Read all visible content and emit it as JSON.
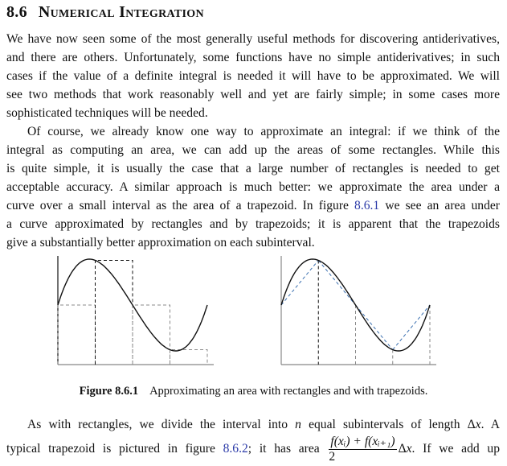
{
  "section": {
    "number": "8.6",
    "title": "Numerical Integration"
  },
  "paragraph1": [
    "We have now seen some of the most generally useful methods for discovering antiderivatives,",
    "and there are others. Unfortunately, some functions have no simple antiderivatives; in such",
    "cases if the value of a definite integral is needed it will have to be approximated. We will",
    "see two methods that work reasonably well and yet are fairly simple; in some cases more",
    "sophisticated techniques will be needed."
  ],
  "paragraph2": [
    "Of course, we already know one way to approximate an integral: if we think of the",
    "integral as computing an area, we can add up the areas of some rectangles. While this",
    "is quite simple, it is usually the case that a large number of rectangles is needed to get",
    "acceptable accuracy. A similar approach is much better: we approximate the area under a",
    {
      "before": "curve over a small interval as the area of a trapezoid. In figure ",
      "link": "8.6.1",
      "after": " we see an area under"
    },
    "a curve approximated by rectangles and by trapezoids; it is apparent that the trapezoids",
    "give a substantially better approximation on each subinterval."
  ],
  "figure": {
    "label": "Figure 8.6.1",
    "caption": "Approximating an area with rectangles and with trapezoids."
  },
  "paragraph3": {
    "line1_a": "As with rectangles, we divide the interval into ",
    "line1_n": "n",
    "line1_b": " equal subintervals of length Δ",
    "line1_x": "x",
    "line1_c": ". A",
    "line2_a": "typical trapezoid is pictured in figure ",
    "line2_link": "8.6.2",
    "line2_b": "; it has area ",
    "frac_num": "f(x_i) + f(x_{i+1})",
    "frac_num_display": "f(xᵢ) + f(xᵢ₊₁)",
    "frac_den": "2",
    "line2_c": "Δ",
    "line2_x": "x",
    "line2_d": ". If we add up"
  },
  "colors": {
    "link": "#2b3aa8",
    "curve": "#111111",
    "dash": "#888888",
    "trap": "#3a6fb0"
  }
}
